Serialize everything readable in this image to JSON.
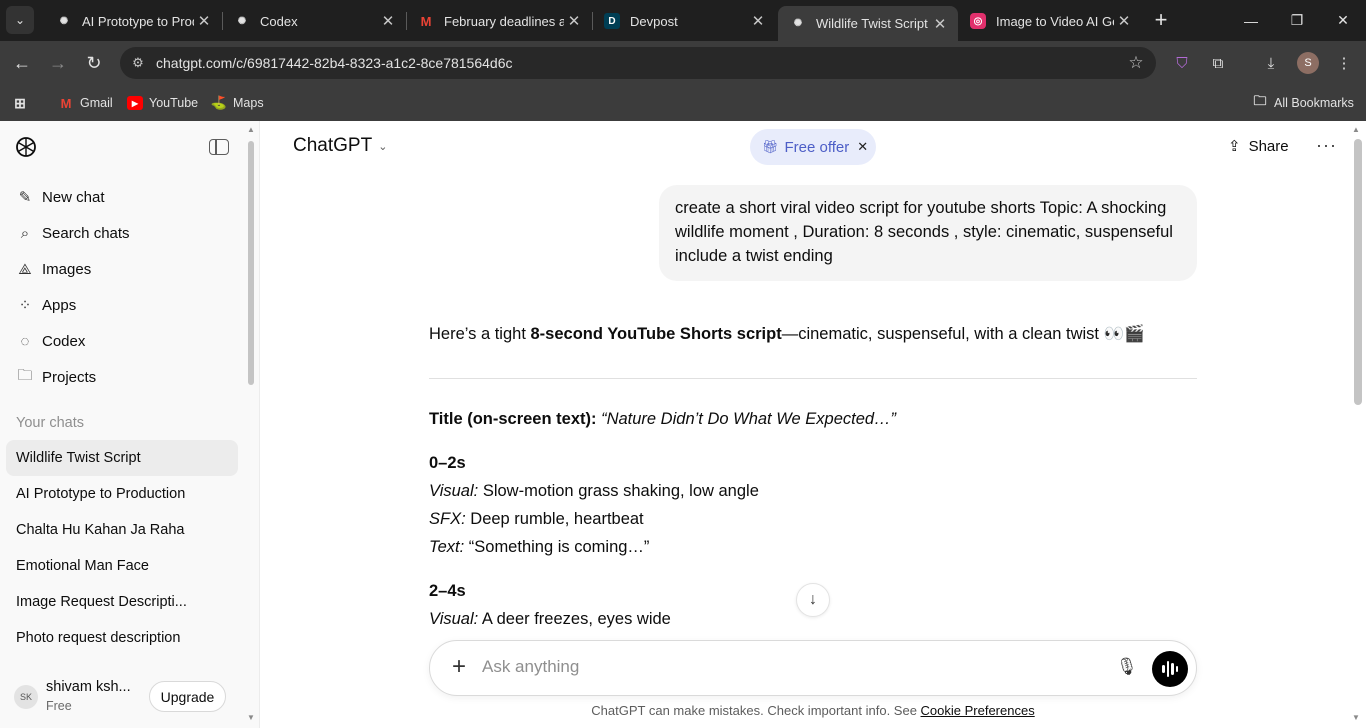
{
  "browser": {
    "tabs": [
      {
        "title": "AI Prototype to Produ",
        "favicon": "chatgpt-icon"
      },
      {
        "title": "Codex",
        "favicon": "chatgpt-icon"
      },
      {
        "title": "February deadlines al",
        "favicon": "gmail-icon"
      },
      {
        "title": "Devpost",
        "favicon": "devpost-icon"
      },
      {
        "title": "Wildlife Twist Script",
        "favicon": "chatgpt-icon"
      },
      {
        "title": "Image to Video AI Ge",
        "favicon": "app-icon"
      }
    ],
    "active_tab": 4,
    "url": "chatgpt.com/c/69817442-82b4-8323-a1c2-8ce781564d6c",
    "profile_initial": "S",
    "bookmarks": [
      {
        "label": "Gmail"
      },
      {
        "label": "YouTube"
      },
      {
        "label": "Maps"
      }
    ],
    "all_bookmarks": "All Bookmarks"
  },
  "sidebar": {
    "nav": [
      {
        "label": "New chat",
        "icon": "edit-icon"
      },
      {
        "label": "Search chats",
        "icon": "search-icon"
      },
      {
        "label": "Images",
        "icon": "images-icon"
      },
      {
        "label": "Apps",
        "icon": "apps-icon"
      },
      {
        "label": "Codex",
        "icon": "codex-icon"
      },
      {
        "label": "Projects",
        "icon": "folder-icon"
      }
    ],
    "section_title": "Your chats",
    "chats": [
      "Wildlife Twist Script",
      "AI Prototype to Production",
      "Chalta Hu Kahan Ja Raha",
      "Emotional Man Face",
      "Image Request Descripti...",
      "Photo request description"
    ],
    "active_chat": 0,
    "user": {
      "initials": "SK",
      "name": "shivam ksh...",
      "plan": "Free",
      "upgrade_label": "Upgrade"
    }
  },
  "header": {
    "model": "ChatGPT",
    "offer": "Free offer",
    "share": "Share"
  },
  "conversation": {
    "user_message": "create a short viral video script for youtube shorts Topic: A shocking wildlife moment , Duration: 8 seconds , style: cinematic, suspenseful include a twist ending",
    "intro_pre": "Here’s a tight ",
    "intro_bold": "8-second YouTube Shorts script",
    "intro_post": "—cinematic, suspenseful, with a clean twist 👀🎬",
    "title_label": "Title (on-screen text):",
    "title_value": "“Nature Didn’t Do What We Expected…”",
    "segments": [
      {
        "time": "0–2s",
        "visual_label": "Visual:",
        "visual": "Slow-motion grass shaking, low angle",
        "sfx_label": "SFX:",
        "sfx": "Deep rumble, heartbeat",
        "text_label": "Text:",
        "text": "“Something is coming…”"
      },
      {
        "time": "2–4s",
        "visual_label": "Visual:",
        "visual": "A deer freezes, eyes wide"
      }
    ]
  },
  "composer": {
    "placeholder": "Ask anything",
    "disclaimer": "ChatGPT can make mistakes. Check important info. See ",
    "disclaimer_link": "Cookie Preferences"
  },
  "colors": {
    "tabbar_bg": "#1f1f1f",
    "toolbar_bg": "#3c3c3c",
    "sidebar_bg": "#f9f9f9",
    "offer_bg": "#e8ecfb",
    "offer_text": "#4d5ec7"
  }
}
